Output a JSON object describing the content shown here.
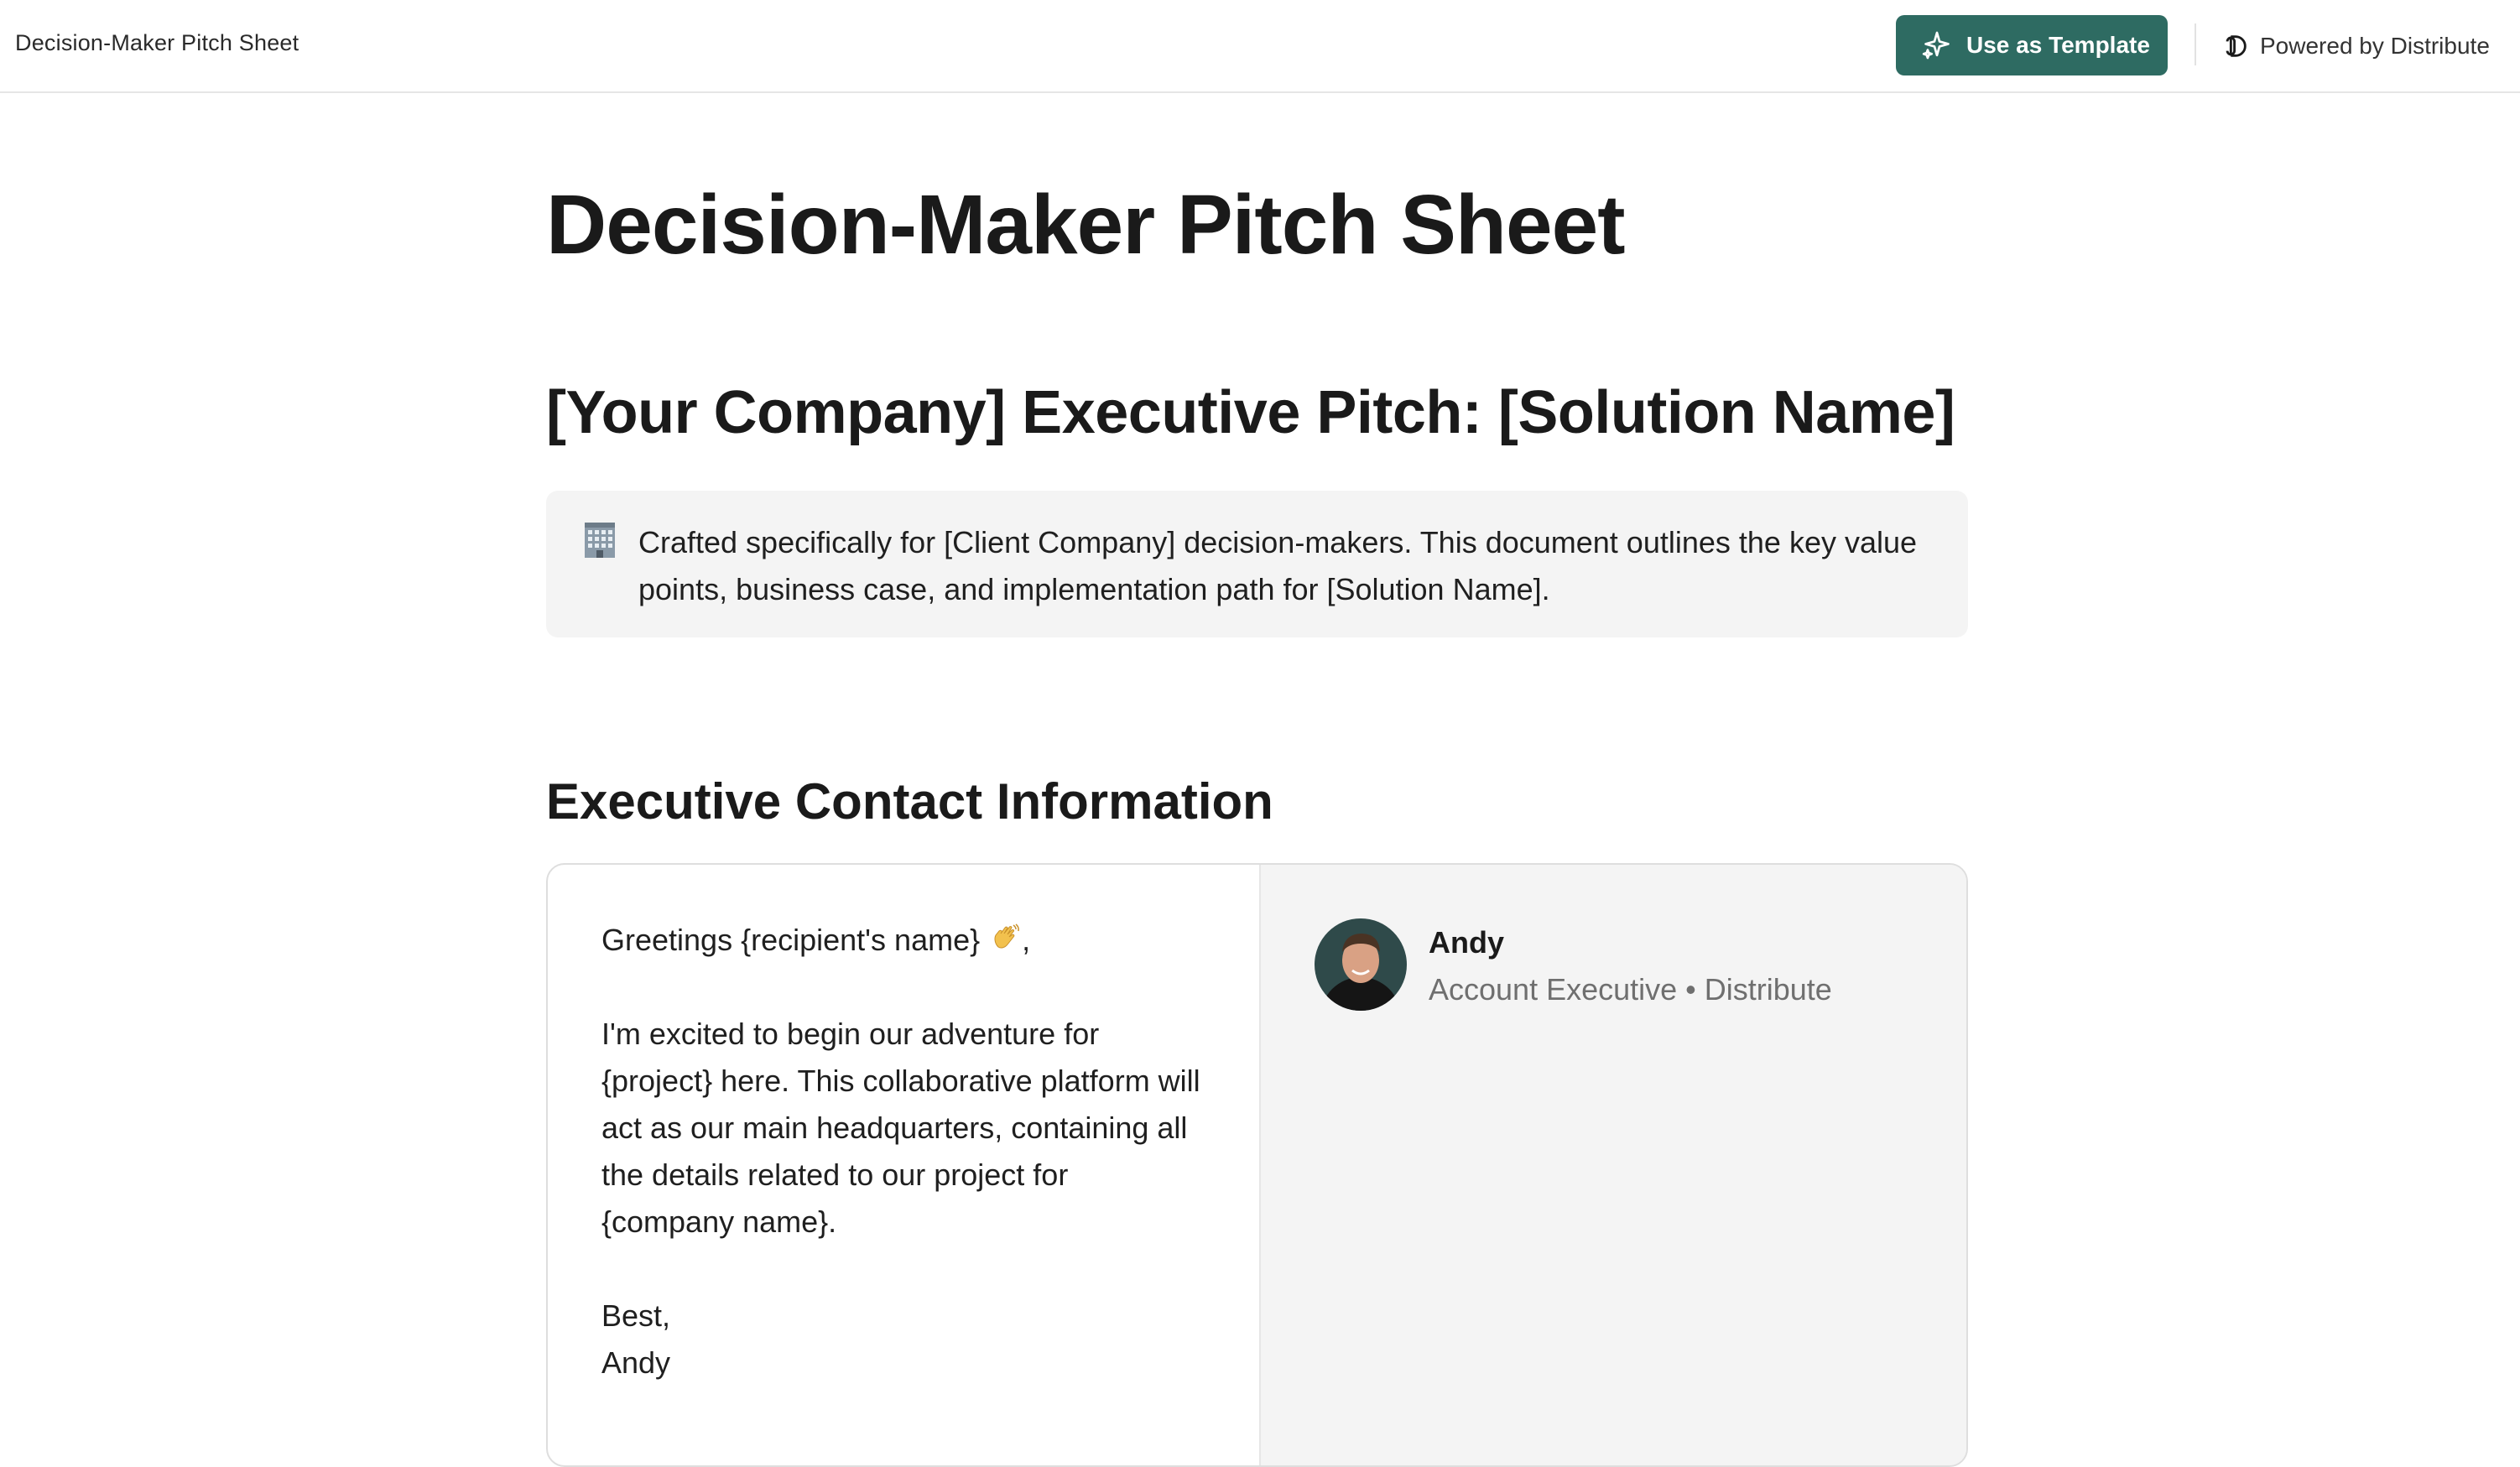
{
  "topbar": {
    "doc_name": "Decision-Maker Pitch Sheet",
    "template_button": "Use as Template",
    "powered_by": "Powered by Distribute",
    "accent_color": "#2e6b62"
  },
  "page": {
    "title": "Decision-Maker Pitch Sheet",
    "pitch_heading": "[Your Company] Executive Pitch: [Solution Name]",
    "callout": {
      "icon": "office-building-icon",
      "text": "Crafted specifically for [Client Company] decision-makers. This document outlines the key value points, business case, and implementation path for [Solution Name]."
    },
    "contact_heading": "Executive Contact Information"
  },
  "contact_card": {
    "greeting": "Greetings {recipient's name} ",
    "greeting_suffix": ",",
    "greeting_icon": "waving-hand-icon",
    "body": "I'm excited to begin our adventure for {project} here. This collaborative platform will act as our main headquarters, containing all the details related to our project for {company name}.",
    "signoff": "Best,",
    "signature": "Andy",
    "rep": {
      "name": "Andy",
      "role": "Account Executive • Distribute"
    }
  }
}
